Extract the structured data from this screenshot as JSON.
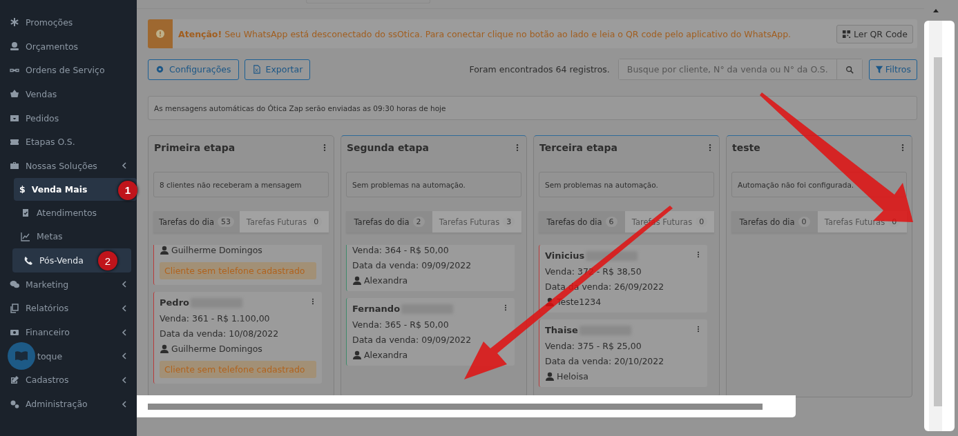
{
  "sidebar": {
    "items": [
      {
        "label": "Promoções",
        "submenu": false
      },
      {
        "label": "Orçamentos",
        "submenu": false
      },
      {
        "label": "Ordens de Serviço",
        "submenu": false
      },
      {
        "label": "Vendas",
        "submenu": false
      },
      {
        "label": "Pedidos",
        "submenu": false
      },
      {
        "label": "Etapas O.S.",
        "submenu": false
      },
      {
        "label": "Nossas Soluções",
        "submenu": true,
        "children": [
          {
            "label": "Venda Mais",
            "icon_text": "$",
            "selected": true,
            "annotation": "1"
          },
          {
            "label": "Atendimentos",
            "selected": false
          },
          {
            "label": "Metas",
            "selected": false
          },
          {
            "label": "Pós-Venda",
            "selected": true,
            "annotation": "2"
          }
        ]
      },
      {
        "label": "Marketing",
        "submenu": true
      },
      {
        "label": "Relatórios",
        "submenu": true
      },
      {
        "label": "Financeiro",
        "submenu": true
      },
      {
        "label": "toque",
        "submenu": true
      },
      {
        "label": "Cadastros",
        "submenu": true
      },
      {
        "label": "Administração",
        "submenu": true
      }
    ]
  },
  "alert": {
    "title": "Atenção!",
    "message": "Seu WhatsApp está desconectado do ssOtica. Para conectar clique no botão ao lado e leia o QR code pelo aplicativo do WhatsApp.",
    "button": "Ler QR Code"
  },
  "toolbar": {
    "buttons": [
      "Configurações",
      "Exportar"
    ],
    "count_text": "Foram encontrados 64 registros.",
    "search": {
      "placeholder": "Busque por cliente, N° da venda ou N° da O.S."
    },
    "filter_button": "Filtros"
  },
  "info": "As mensagens automáticas do Ótica Zap serão enviadas as 09:30 horas de hoje",
  "columns": [
    {
      "title": "Primeira etapa",
      "status": "8 clientes não receberam a mensagem",
      "tabs": [
        {
          "label": "Tarefas do dia",
          "count": "53",
          "selected": true
        },
        {
          "label": "Tarefas Futuras",
          "count": "0",
          "selected": false
        }
      ],
      "cards": [
        {
          "seller": "Guilherme Domingos",
          "warning": "Cliente sem telefone cadastrado",
          "color": "#b83a3a"
        },
        {
          "name": "Pedro",
          "redacted": true,
          "sale": "Venda: 361 - R$ 1.100,00",
          "date": "Data da venda: 10/08/2022",
          "seller": "Guilherme Domingos",
          "warning": "Cliente sem telefone cadastrado",
          "color": "#b83a3a"
        }
      ]
    },
    {
      "title": "Segunda etapa",
      "status": "Sem problemas na automação.",
      "tabs": [
        {
          "label": "Tarefas do dia",
          "count": "2",
          "selected": true
        },
        {
          "label": "Tarefas Futuras",
          "count": "3",
          "selected": false
        }
      ],
      "cards": [
        {
          "sale": "Venda: 364 - R$ 50,00",
          "date": "Data da venda: 09/09/2022",
          "seller": "Alexandra",
          "color": "#3f8a6a"
        },
        {
          "name": "Fernando",
          "redacted": true,
          "sale": "Venda: 365 - R$ 50,00",
          "date": "Data da venda: 09/09/2022",
          "seller": "Alexandra",
          "color": "#3f8a6a"
        }
      ]
    },
    {
      "title": "Terceira etapa",
      "status": "Sem problemas na automação.",
      "tabs": [
        {
          "label": "Tarefas do dia",
          "count": "6",
          "selected": true
        },
        {
          "label": "Tarefas Futuras",
          "count": "0",
          "selected": false
        }
      ],
      "cards": [
        {
          "name": "Vinicius",
          "redacted": true,
          "sale": "Venda: 372 - R$ 38,50",
          "date": "Data da venda: 26/09/2022",
          "seller": "Teste1234",
          "color": "#b83a3a"
        },
        {
          "name": "Thaise",
          "redacted": true,
          "sale": "Venda: 375 - R$ 25,00",
          "date": "Data da venda: 20/10/2022",
          "seller": "Heloisa",
          "color": "#b83a3a"
        }
      ]
    },
    {
      "title": "teste",
      "status": "Automação não foi configurada.",
      "tabs": [
        {
          "label": "Tarefas do dia",
          "count": "0",
          "selected": true
        },
        {
          "label": "Tarefas Futuras",
          "count": "0",
          "selected": false
        }
      ]
    }
  ]
}
